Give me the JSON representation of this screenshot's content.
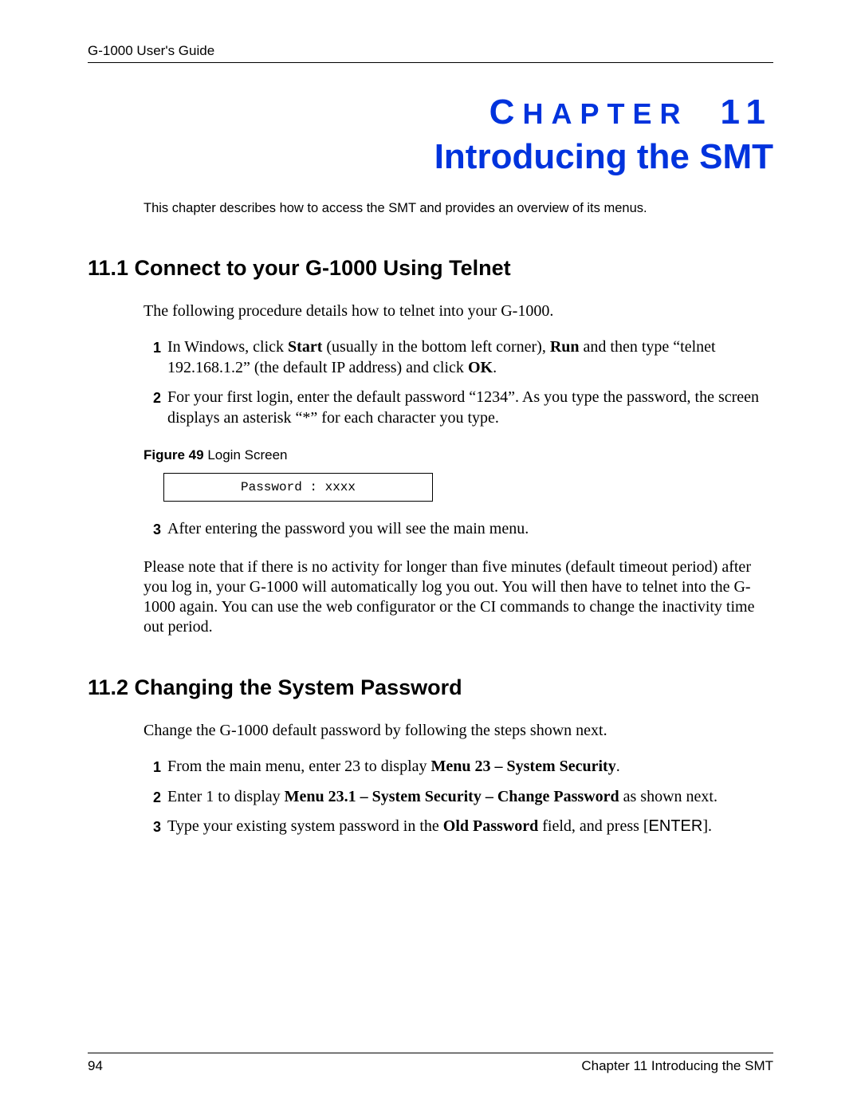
{
  "header": {
    "guide": "G-1000 User's Guide"
  },
  "chapter": {
    "label_small": "C",
    "label_rest": "HAPTER",
    "number": "11",
    "title": "Introducing the SMT"
  },
  "intro": "This chapter describes how to access the SMT and provides an overview of its menus.",
  "s11_1": {
    "heading": "11.1  Connect to your G-1000 Using Telnet",
    "lead": "The following procedure details how to telnet into your G-1000.",
    "item1_pre": "In Windows, click ",
    "item1_b1": "Start",
    "item1_mid1": " (usually in the bottom left corner), ",
    "item1_b2": "Run",
    "item1_mid2": " and then type “telnet 192.168.1.2” (the default IP address) and click ",
    "item1_b3": "OK",
    "item1_end": ".",
    "item2": "For your first login, enter the default password “1234”. As you type the password, the screen displays an asterisk “*” for each character you type.",
    "figure_label": "Figure 49",
    "figure_title": "   Login Screen",
    "login_box": "Password : xxxx",
    "item3": "After entering the password you will see the main menu.",
    "note": "Please note that if there is no activity for longer than five minutes (default timeout period) after you log in, your G-1000 will automatically log you out. You will then have to telnet into the G-1000 again. You can use the web configurator or the CI commands to change the inactivity time out period."
  },
  "s11_2": {
    "heading": "11.2  Changing the System Password",
    "lead": "Change the G-1000 default password by following the steps shown next.",
    "item1_pre": "From the main menu, enter 23 to display ",
    "item1_b": "Menu 23 – System Security",
    "item1_end": ".",
    "item2_pre": "Enter 1 to display ",
    "item2_b": "Menu 23.1 – System Security – Change Password",
    "item2_end": " as shown next.",
    "item3_pre": "Type your existing system password in the ",
    "item3_b": "Old Password",
    "item3_mid": " field, and press [",
    "item3_key": "ENTER",
    "item3_end": "]."
  },
  "footer": {
    "page": "94",
    "right": "Chapter 11 Introducing the SMT"
  }
}
